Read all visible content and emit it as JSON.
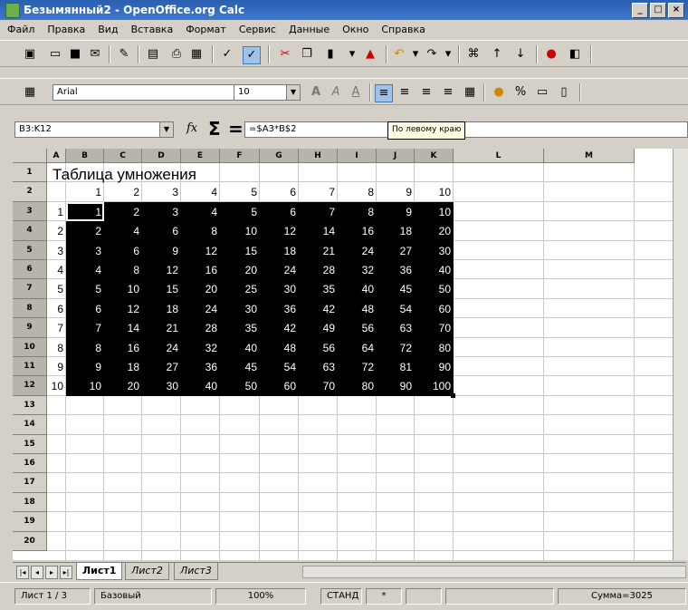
{
  "window": {
    "title": "Безымянный2 - OpenOffice.org Calc",
    "buttons": [
      "_",
      "□",
      "×"
    ]
  },
  "menu": [
    "Файл",
    "Правка",
    "Вид",
    "Вставка",
    "Формат",
    "Сервис",
    "Данные",
    "Окно",
    "Справка"
  ],
  "toolbar_format": {
    "font_name": "Arial",
    "font_size": "10"
  },
  "formula_bar": {
    "cell_ref": "B3:K12",
    "func_icon": "fx",
    "sum_icon": "Σ",
    "equals_icon": "=",
    "formula": "=$A3*B$2"
  },
  "tooltip": "По левому краю",
  "columns": [
    "A",
    "B",
    "C",
    "D",
    "E",
    "F",
    "G",
    "H",
    "I",
    "J",
    "K",
    "L",
    "M"
  ],
  "rows": [
    "1",
    "2",
    "3",
    "4",
    "5",
    "6",
    "7",
    "8",
    "9",
    "10",
    "11",
    "12",
    "13",
    "14",
    "15",
    "16",
    "17",
    "18",
    "19",
    "20"
  ],
  "sheet": {
    "title": "Таблица умножения",
    "header_row": [
      "1",
      "2",
      "3",
      "4",
      "5",
      "6",
      "7",
      "8",
      "9",
      "10"
    ],
    "row_labels": [
      "1",
      "2",
      "3",
      "4",
      "5",
      "6",
      "7",
      "8",
      "9",
      "10"
    ],
    "table": [
      [
        "1",
        "2",
        "3",
        "4",
        "5",
        "6",
        "7",
        "8",
        "9",
        "10"
      ],
      [
        "2",
        "4",
        "6",
        "8",
        "10",
        "12",
        "14",
        "16",
        "18",
        "20"
      ],
      [
        "3",
        "6",
        "9",
        "12",
        "15",
        "18",
        "21",
        "24",
        "27",
        "30"
      ],
      [
        "4",
        "8",
        "12",
        "16",
        "20",
        "24",
        "28",
        "32",
        "36",
        "40"
      ],
      [
        "5",
        "10",
        "15",
        "20",
        "25",
        "30",
        "35",
        "40",
        "45",
        "50"
      ],
      [
        "6",
        "12",
        "18",
        "24",
        "30",
        "36",
        "42",
        "48",
        "54",
        "60"
      ],
      [
        "7",
        "14",
        "21",
        "28",
        "35",
        "42",
        "49",
        "56",
        "63",
        "70"
      ],
      [
        "8",
        "16",
        "24",
        "32",
        "40",
        "48",
        "56",
        "64",
        "72",
        "80"
      ],
      [
        "9",
        "18",
        "27",
        "36",
        "45",
        "54",
        "63",
        "72",
        "81",
        "90"
      ],
      [
        "10",
        "20",
        "30",
        "40",
        "50",
        "60",
        "70",
        "80",
        "90",
        "100"
      ]
    ]
  },
  "sheet_tabs": [
    "Лист1",
    "Лист2",
    "Лист3"
  ],
  "status": {
    "sheet": "Лист 1 / 3",
    "style": "Базовый",
    "zoom": "100%",
    "mode": "СТАНД",
    "modified": "*",
    "sum": "Сумма=3025"
  }
}
